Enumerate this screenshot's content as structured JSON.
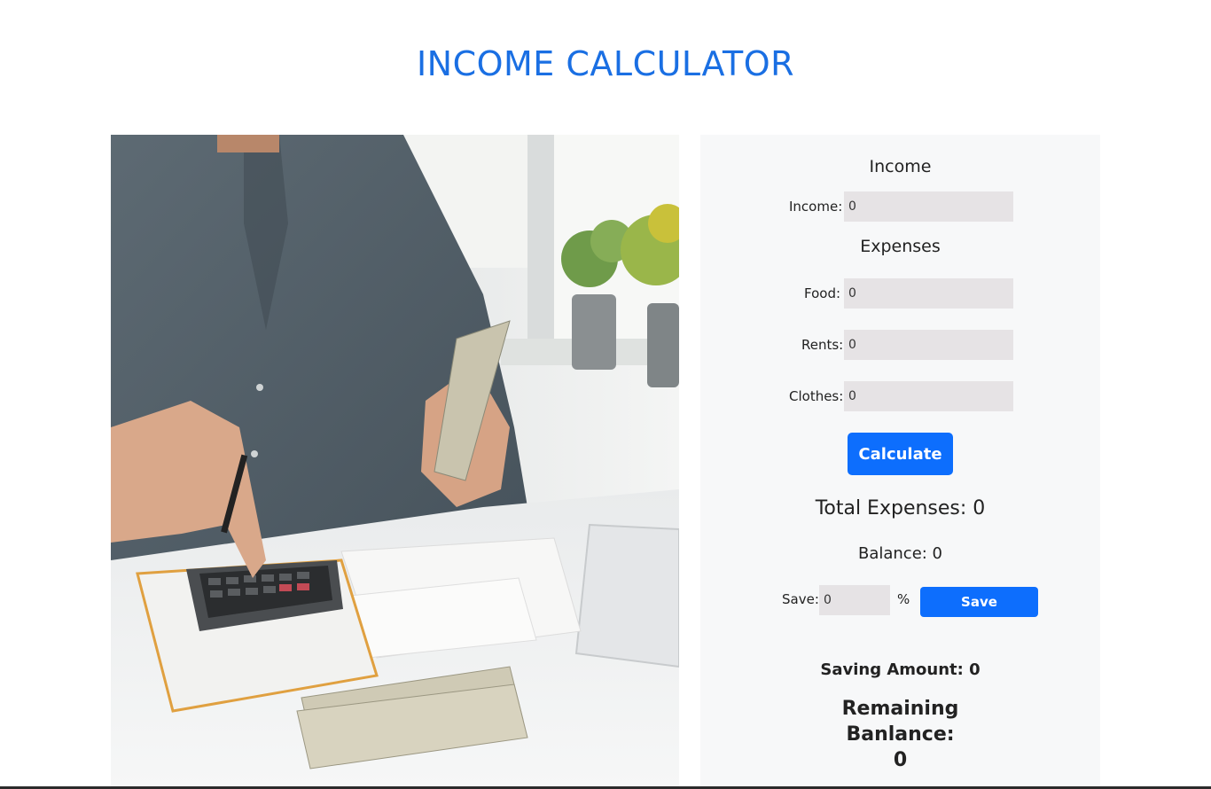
{
  "page": {
    "title": "INCOME CALCULATOR",
    "accent_color": "#1a6fe3",
    "button_color": "#0d6efd"
  },
  "photo": {
    "subject": "person-using-calculator-with-cash-and-receipts"
  },
  "income_section": {
    "heading": "Income",
    "income_label": "Income:",
    "income_value": "0"
  },
  "expenses_section": {
    "heading": "Expenses",
    "food_label": "Food:",
    "food_value": "0",
    "rents_label": "Rents:",
    "rents_value": "0",
    "clothes_label": "Clothes:",
    "clothes_value": "0"
  },
  "actions": {
    "calculate_label": "Calculate",
    "save_label": "Save"
  },
  "results": {
    "total_expenses": "Total Expenses: 0",
    "balance": "Balance: 0",
    "save_field_label": "Save:",
    "save_value": "0",
    "percent_sign": "%",
    "saving_amount": "Saving Amount: 0",
    "remaining_label": "Remaining Banlance:",
    "remaining_value": "0"
  }
}
